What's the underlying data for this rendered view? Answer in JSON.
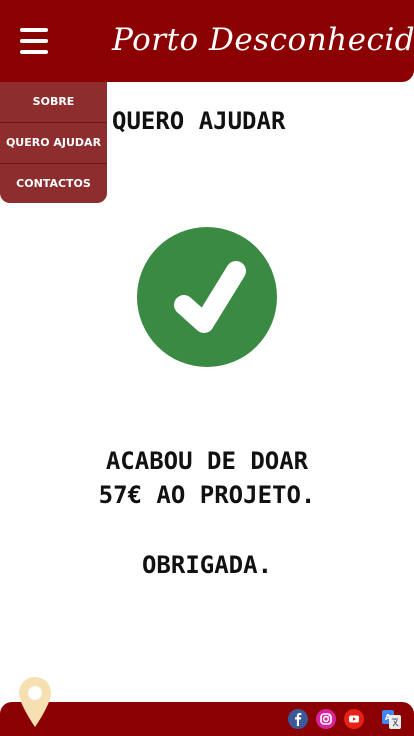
{
  "header": {
    "brand": "Porto Desconhecido",
    "menu_icon": "hamburger-menu-icon"
  },
  "menu": {
    "items": [
      {
        "label": "SOBRE"
      },
      {
        "label": "QUERO AJUDAR"
      },
      {
        "label": "CONTACTOS"
      }
    ]
  },
  "main": {
    "title": "QUERO AJUDAR",
    "check_icon": "checkmark-icon",
    "message_line1": "ACABOU DE DOAR",
    "message_line2": "57€ AO PROJETO.",
    "thanks": "OBRIGADA."
  },
  "footer": {
    "social_icons": [
      "facebook-icon",
      "instagram-icon",
      "youtube-icon"
    ],
    "translate_icon": "translate-icon",
    "location_icon": "location-pin-icon"
  },
  "colors": {
    "brand_red": "#8b0000",
    "menu_bg": "#8d2d2d",
    "success_green": "#3a8a43",
    "pin": "#f5deb3"
  }
}
